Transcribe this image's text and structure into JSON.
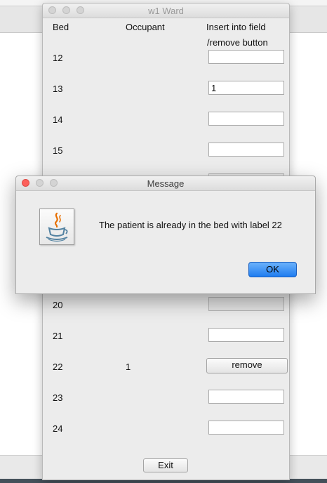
{
  "ward_window": {
    "title": "w1 Ward",
    "headers": {
      "bed": "Bed",
      "occupant": "Occupant",
      "insert_line1": "Insert into field",
      "insert_line2": "/remove button"
    },
    "rows_top": [
      {
        "bed": "12",
        "occupant": "",
        "field_value": ""
      },
      {
        "bed": "13",
        "occupant": "",
        "field_value": "1"
      },
      {
        "bed": "14",
        "occupant": "",
        "field_value": ""
      },
      {
        "bed": "15",
        "occupant": "",
        "field_value": ""
      }
    ],
    "rows_bottom": [
      {
        "bed": "20",
        "occupant": "",
        "field_value": ""
      },
      {
        "bed": "21",
        "occupant": "",
        "field_value": ""
      },
      {
        "bed": "22",
        "occupant": "1",
        "button_label": "remove"
      },
      {
        "bed": "23",
        "occupant": "",
        "field_value": ""
      },
      {
        "bed": "24",
        "occupant": "",
        "field_value": ""
      }
    ],
    "exit_label": "Exit"
  },
  "dialog": {
    "title": "Message",
    "message": "The patient is already in the bed with label 22",
    "ok_label": "OK",
    "icon": "java-coffee-cup-icon"
  },
  "colors": {
    "close_red": "#fc605b",
    "ok_blue": "#1e7cf0"
  }
}
